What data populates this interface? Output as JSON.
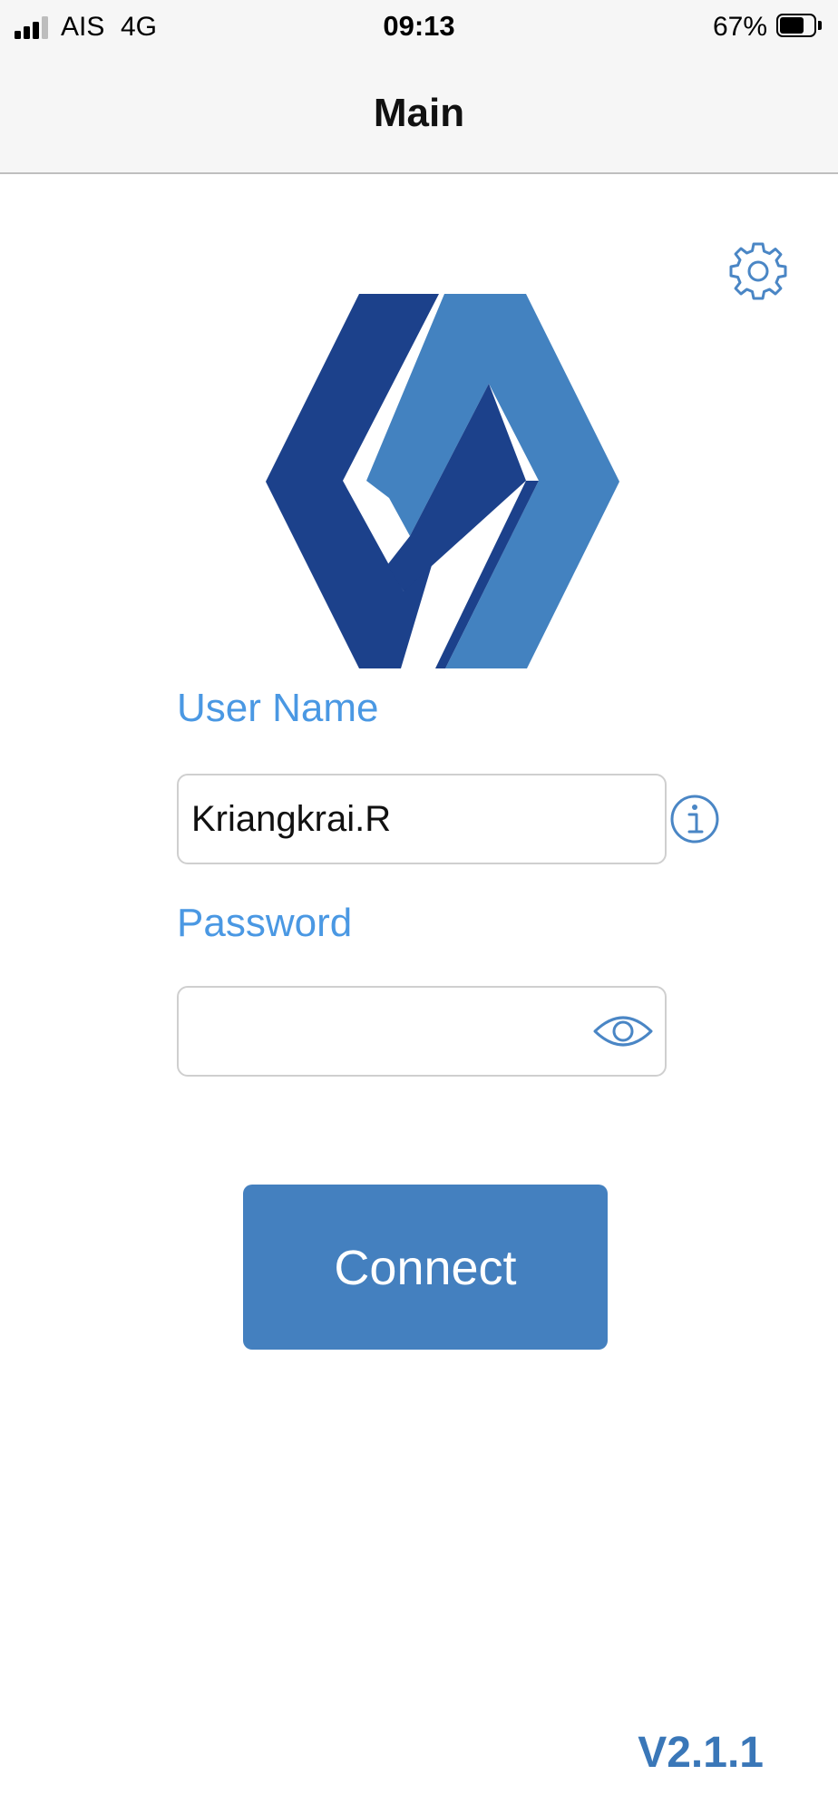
{
  "status_bar": {
    "carrier": "AIS",
    "network": "4G",
    "time": "09:13",
    "battery": "67%",
    "battery_level": 0.67,
    "signal_bars_filled": 3,
    "signal_bars_total": 4
  },
  "nav": {
    "title": "Main"
  },
  "settings": {
    "icon": "gear-icon"
  },
  "logo": {
    "icon": "company-logo",
    "colors": {
      "dark": "#1c418b",
      "light": "#4382c0"
    }
  },
  "form": {
    "username_label": "User Name",
    "username_value": "Kriangkrai.R",
    "info_icon": "info-icon",
    "password_label": "Password",
    "password_value": "",
    "eye_icon": "eye-icon"
  },
  "connect_button": {
    "label": "Connect"
  },
  "version": "V2.1.1",
  "colors": {
    "accent": "#4a98e3",
    "button": "#4480bf",
    "version": "#3a77b8",
    "icon": "#4a86c5"
  }
}
